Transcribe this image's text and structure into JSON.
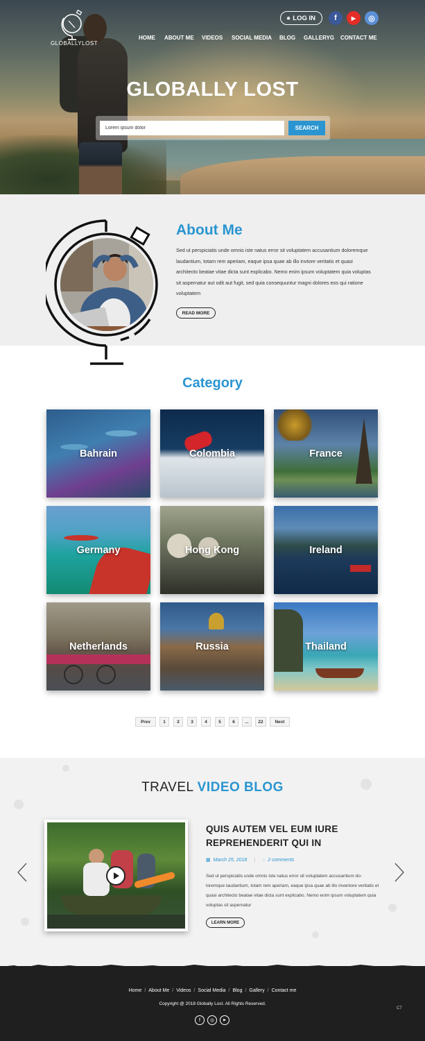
{
  "header": {
    "logo_text": "GLOBALLYLOST",
    "login_label": "LOG IN",
    "social": [
      {
        "name": "facebook",
        "glyph": "f",
        "color": "#3b5998"
      },
      {
        "name": "youtube",
        "glyph": "▶",
        "color": "#e52d27"
      },
      {
        "name": "instagram",
        "glyph": "◎",
        "color": "#5b8fd6"
      }
    ],
    "nav": [
      "HOME",
      "ABOUT ME",
      "VIDEOS",
      "SOCIAL MEDIA",
      "BLOG",
      "GALLERYG",
      "CONTACT ME"
    ]
  },
  "hero": {
    "title": "GLOBALLY LOST",
    "search_value": "Lorem ipsum dolor",
    "search_button": "SEARCH"
  },
  "about": {
    "title": "About Me",
    "text": "Sed ut perspiciatis unde omnis iste natus error sit voluptatem accusantium doloremque laudantium, totam rem aperiam, eaque ipsa quae ab illo invtore veritatis et quasi architecto beatae vitae dicta sunt explicabo. Nemo enim ipsum voluptatem quia voluptas sit aspernatur aut odit aut fugit, sed quia consequuntur magni dolores eos qui ratione voluptatem",
    "button": "READ MORE"
  },
  "category": {
    "title": "Category",
    "items": [
      "Bahrain",
      "Colombia",
      "France",
      "Germany",
      "Hong Kong",
      "Ireland",
      "Netherlands",
      "Russia",
      "Thailand"
    ]
  },
  "pagination": {
    "prev": "Prev",
    "pages": [
      "1",
      "2",
      "3",
      "4",
      "5",
      "6",
      "...",
      "22"
    ],
    "next": "Next"
  },
  "video_blog": {
    "title_plain": "TRAVEL ",
    "title_accent": "VIDEO BLOG",
    "post_title": "QUIS AUTEM VEL EUM IURE REPREHENDERIT QUI IN",
    "date": "March 25, 2018",
    "comments": "2 comments",
    "text": "Sed ut perspiciatis unde omnis iste natus error sit voluptatem accusantium do-loremque laudantium, totam rem aperiam, eaque ipsa quae ab illo inventore veritatis et quasi architecto beatae vitae dicta sunt explicabo. Nemo enim ipsum voluptatem quia voluptas sit aspernatur",
    "button": "LEARN MORE"
  },
  "footer": {
    "nav": [
      "Home",
      "About Me",
      "Videos",
      "Social Media",
      "Blog",
      "Gallery",
      "Contact me"
    ],
    "copyright": "Copyright @ 2018 Globally Lost. All Rights Reserved.",
    "corner": "C7",
    "social": [
      "f",
      "◎",
      "▶"
    ]
  },
  "colors": {
    "accent": "#2a95d1",
    "footer_bg": "#1f1f1f",
    "about_bg": "#efefef"
  }
}
